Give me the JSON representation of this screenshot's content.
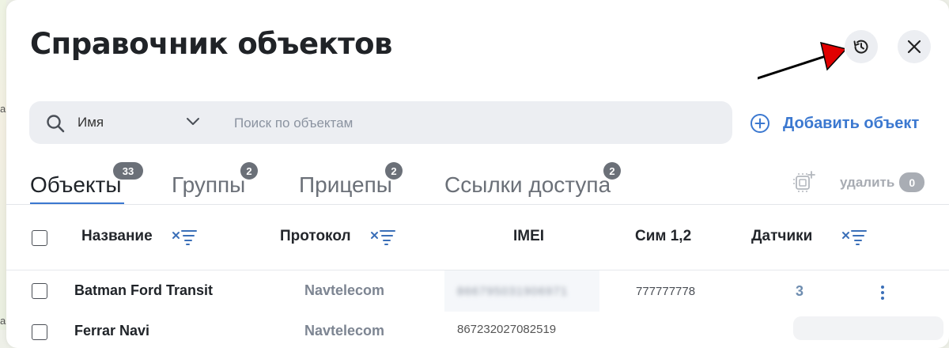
{
  "dialog": {
    "title": "Справочник объектов",
    "history_icon": "history-icon",
    "close_icon": "close-icon"
  },
  "search": {
    "field_selector": "Имя",
    "placeholder": "Поиск по объектам"
  },
  "actions": {
    "add_object": "Добавить объект",
    "delete_label": "удалить",
    "delete_count": "0"
  },
  "tabs": [
    {
      "label": "Объекты",
      "count": "33",
      "active": true
    },
    {
      "label": "Группы",
      "count": "2"
    },
    {
      "label": "Прицепы",
      "count": "2"
    },
    {
      "label": "Ссылки доступа",
      "count": "2"
    }
  ],
  "table": {
    "columns": [
      {
        "label": "Название",
        "sortable": true
      },
      {
        "label": "Протокол",
        "sortable": true
      },
      {
        "label": "IMEI",
        "sortable": false
      },
      {
        "label": "Сим 1,2",
        "sortable": false
      },
      {
        "label": "Датчики",
        "sortable": true
      }
    ],
    "rows": [
      {
        "name": "Batman Ford Transit",
        "protocol": "Navtelecom",
        "imei": "866795031906971",
        "sim": "777777778",
        "sensors": "3"
      },
      {
        "name": "Ferrar Navi",
        "protocol": "Navtelecom",
        "imei": "867232027082519",
        "sim": "",
        "sensors": ""
      }
    ]
  },
  "colors": {
    "accent": "#3b78d0",
    "badge": "#6b7078",
    "search_bg": "#eceef2",
    "annotation_arrow": "#e00000"
  }
}
